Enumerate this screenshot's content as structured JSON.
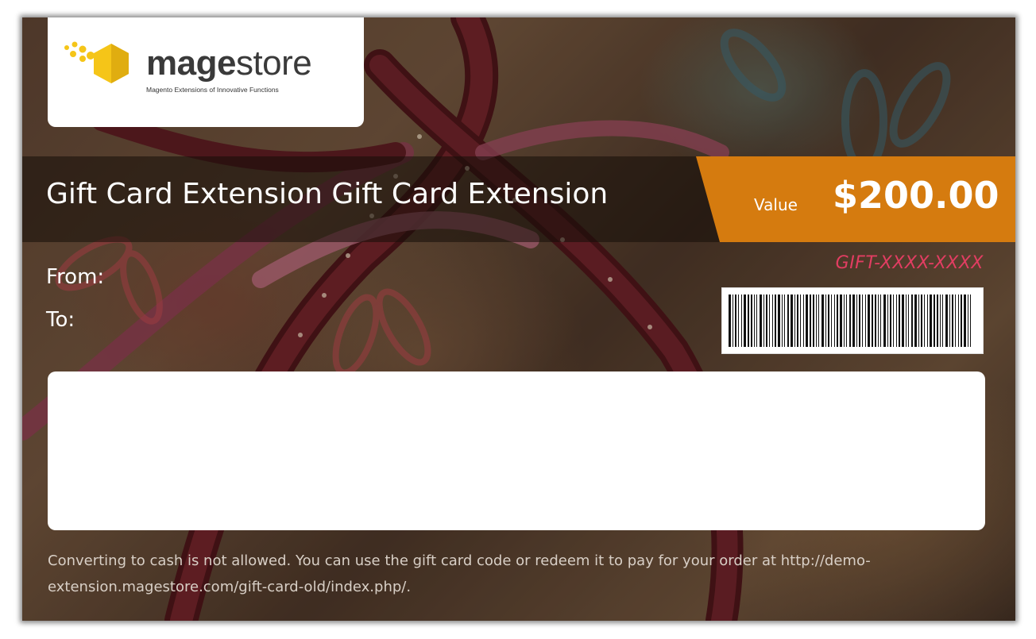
{
  "logo": {
    "name_bold": "mage",
    "name_rest": "store",
    "tagline": "Magento Extensions of Innovative Functions",
    "icon": "hexagon-logo-icon",
    "accent_color": "#f5c518"
  },
  "card": {
    "title": "Gift Card Extension Gift Card Extension",
    "value_label": "Value",
    "value_amount": "$200.00",
    "value_color": "#d57b0f",
    "code": "GIFT-XXXX-XXXX",
    "code_color": "#e23d62",
    "from_label": "From:",
    "to_label": "To:",
    "message": "",
    "footer_note": "Converting to cash is not allowed. You can use the gift card code or redeem it to pay for your order at http://demo-extension.magestore.com/gift-card-old/index.php/."
  }
}
